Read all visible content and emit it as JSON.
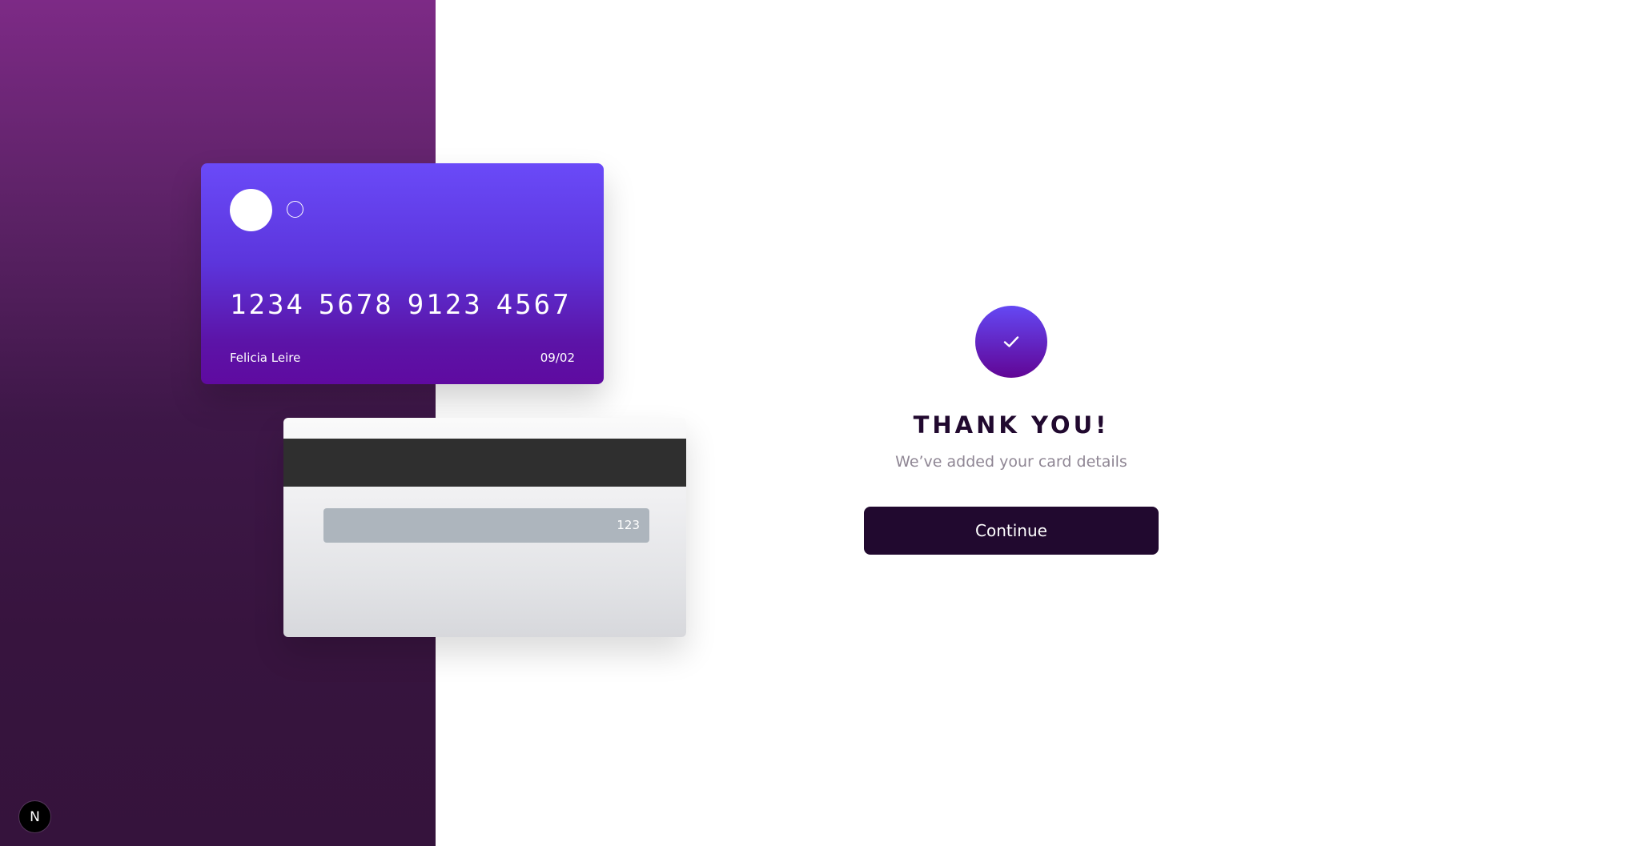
{
  "card_front": {
    "number_groups": [
      "1234",
      "5678",
      "9123",
      "4567"
    ],
    "holder": "Felicia Leire",
    "expiry": "09/02"
  },
  "card_back": {
    "cvc": "123"
  },
  "complete": {
    "title": "THANK YOU!",
    "subtitle": "We’ve added your card details",
    "button_label": "Continue"
  },
  "badge": {
    "label": "N"
  },
  "icons": {
    "check": "check-icon",
    "badge": "next-logo-icon"
  },
  "colors": {
    "dark_violet": "#21092f",
    "gradient_start": "#6448fe",
    "gradient_end": "#610595",
    "subtitle_gray": "#8f8694"
  }
}
